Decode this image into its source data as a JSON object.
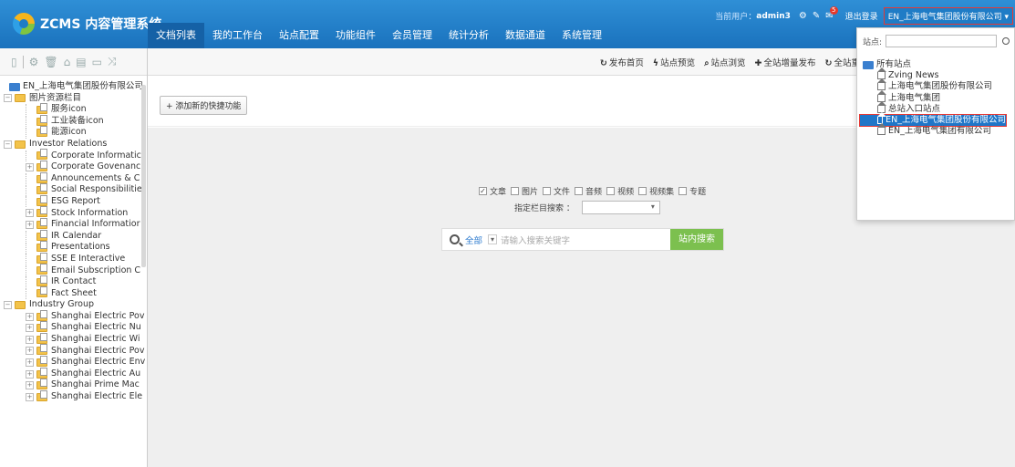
{
  "header": {
    "app_title": "ZCMS 内容管理系统",
    "nav": [
      "文档列表",
      "我的工作台",
      "站点配置",
      "功能组件",
      "会员管理",
      "统计分析",
      "数据通道",
      "系统管理"
    ],
    "current_user_label": "当前用户：",
    "current_user": "admin3",
    "notification_count": "5",
    "logout_label": "退出登录",
    "current_site": "EN_上海电气集团股份有限公司 ▾"
  },
  "sidebar": {
    "toolbar_icons": [
      "doc-icon",
      "settings-icon",
      "trash-icon",
      "lock-icon",
      "list-icon",
      "comment-icon",
      "shuffle-icon"
    ],
    "root": "EN_上海电气集团股份有限公司",
    "items": [
      {
        "label": "图片资源栏目",
        "level": 1,
        "expand": "−"
      },
      {
        "label": "服务icon",
        "level": 2,
        "expand": ""
      },
      {
        "label": "工业装备icon",
        "level": 2,
        "expand": ""
      },
      {
        "label": "能源icon",
        "level": 2,
        "expand": ""
      },
      {
        "label": "Investor Relations",
        "level": 1,
        "expand": "−"
      },
      {
        "label": "Corporate Informatic",
        "level": 2,
        "expand": ""
      },
      {
        "label": "Corporate Govenanc",
        "level": 2,
        "expand": "+"
      },
      {
        "label": "Announcements & C",
        "level": 2,
        "expand": ""
      },
      {
        "label": "Social Responsibilitie",
        "level": 2,
        "expand": ""
      },
      {
        "label": "ESG Report",
        "level": 2,
        "expand": ""
      },
      {
        "label": "Stock Information",
        "level": 2,
        "expand": "+"
      },
      {
        "label": "Financial Informatior",
        "level": 2,
        "expand": "+"
      },
      {
        "label": "IR Calendar",
        "level": 2,
        "expand": ""
      },
      {
        "label": "Presentations",
        "level": 2,
        "expand": ""
      },
      {
        "label": "SSE E Interactive",
        "level": 2,
        "expand": ""
      },
      {
        "label": "Email Subscription C",
        "level": 2,
        "expand": ""
      },
      {
        "label": "IR Contact",
        "level": 2,
        "expand": ""
      },
      {
        "label": "Fact Sheet",
        "level": 2,
        "expand": ""
      },
      {
        "label": "Industry Group",
        "level": 1,
        "expand": "−"
      },
      {
        "label": "Shanghai Electric Pov",
        "level": 2,
        "expand": "+"
      },
      {
        "label": "Shanghai Electric Nu",
        "level": 2,
        "expand": "+"
      },
      {
        "label": "Shanghai Electric Wi",
        "level": 2,
        "expand": "+"
      },
      {
        "label": "Shanghai Electric Pov",
        "level": 2,
        "expand": "+"
      },
      {
        "label": "Shanghai Electric Env",
        "level": 2,
        "expand": "+"
      },
      {
        "label": "Shanghai Electric Au",
        "level": 2,
        "expand": "+"
      },
      {
        "label": "Shanghai Prime Mac",
        "level": 2,
        "expand": "+"
      },
      {
        "label": "Shanghai Electric Ele",
        "level": 2,
        "expand": "+"
      }
    ]
  },
  "main_toolbar": [
    {
      "icon": "↻",
      "label": "发布首页"
    },
    {
      "icon": "ϟ",
      "label": "站点预览"
    },
    {
      "icon": "⌕",
      "label": "站点浏览"
    },
    {
      "icon": "✚",
      "label": "全站增量发布"
    },
    {
      "icon": "↻",
      "label": "全站重"
    }
  ],
  "quick_add_label": "+ 添加新的快捷功能",
  "filters": [
    {
      "label": "文章",
      "checked": true
    },
    {
      "label": "图片",
      "checked": false
    },
    {
      "label": "文件",
      "checked": false
    },
    {
      "label": "音频",
      "checked": false
    },
    {
      "label": "视频",
      "checked": false
    },
    {
      "label": "视频集",
      "checked": false
    },
    {
      "label": "专题",
      "checked": false
    }
  ],
  "column_search_label": "指定栏目搜索 ：",
  "search": {
    "scope": "全部",
    "placeholder": "请输入搜索关键字",
    "button": "站内搜索"
  },
  "site_dropdown": {
    "search_label": "站点:",
    "root": "所有站点",
    "sites": [
      "Zving News",
      "上海电气集团股份有限公司",
      "上海电气集团",
      "总站入口站点",
      "EN_上海电气集团股份有限公司",
      "EN_上海电气集团有限公司"
    ],
    "selected_index": 4
  },
  "colors": {
    "header": "#1f7cc6",
    "accent_green": "#7cc04f",
    "highlight_red": "#e53935",
    "selected_blue": "#1f76c8"
  }
}
